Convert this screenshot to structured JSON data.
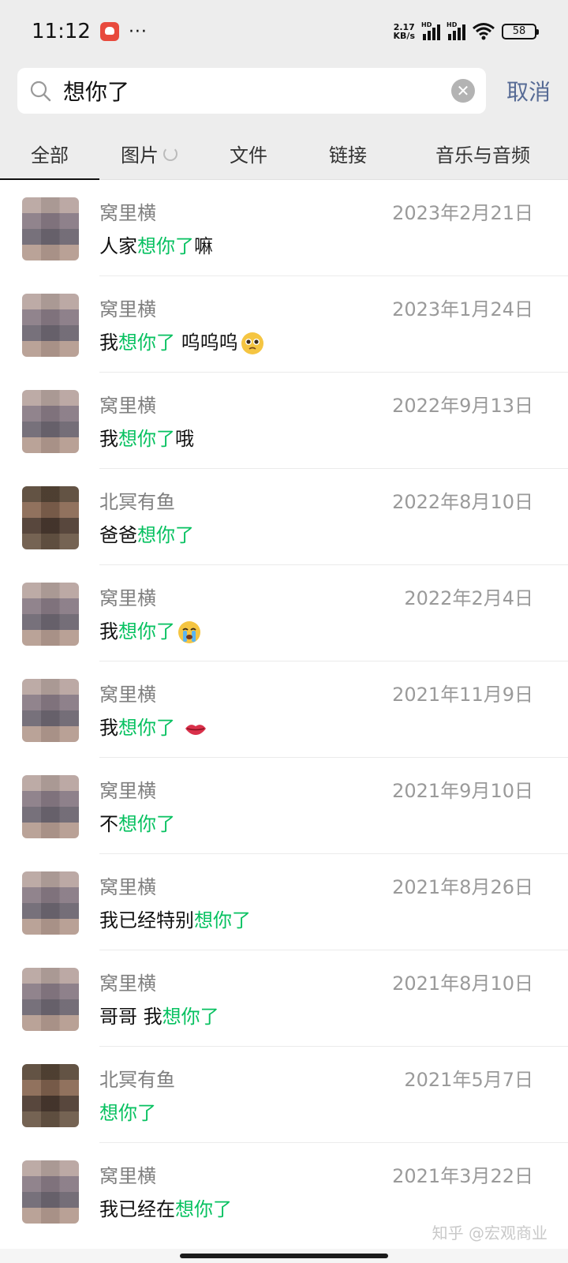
{
  "status_bar": {
    "time": "11:12",
    "dots": "···",
    "net_speed_value": "2.17",
    "net_speed_unit": "KB/s",
    "hd1": "HD",
    "hd2": "HD",
    "battery": "58"
  },
  "search": {
    "query": "想你了",
    "cancel_label": "取消"
  },
  "tabs": [
    {
      "label": "全部",
      "active": true
    },
    {
      "label": "图片",
      "active": false
    },
    {
      "label": "文件",
      "active": false
    },
    {
      "label": "链接",
      "active": false
    },
    {
      "label": "音乐与音频",
      "active": false
    }
  ],
  "highlight_color": "#07c160",
  "results": [
    {
      "sender": "窝里横",
      "date": "2023年2月21日",
      "pre": "人家",
      "hl": "想你了",
      "post": "嘛",
      "emoji": ""
    },
    {
      "sender": "窝里横",
      "date": "2023年1月24日",
      "pre": "我",
      "hl": "想你了",
      "post": " 呜呜呜",
      "emoji": "pleading-face"
    },
    {
      "sender": "窝里横",
      "date": "2022年9月13日",
      "pre": "我",
      "hl": "想你了",
      "post": "哦",
      "emoji": ""
    },
    {
      "sender": "北冥有鱼",
      "date": "2022年8月10日",
      "pre": "爸爸",
      "hl": "想你了",
      "post": "",
      "emoji": ""
    },
    {
      "sender": "窝里横",
      "date": "2022年2月4日",
      "pre": "我",
      "hl": "想你了",
      "post": "",
      "emoji": "crying-face"
    },
    {
      "sender": "窝里横",
      "date": "2021年11月9日",
      "pre": "我",
      "hl": "想你了",
      "post": " ",
      "emoji": "kiss-lips"
    },
    {
      "sender": "窝里横",
      "date": "2021年9月10日",
      "pre": "不",
      "hl": "想你了",
      "post": "",
      "emoji": ""
    },
    {
      "sender": "窝里横",
      "date": "2021年8月26日",
      "pre": "我已经特别",
      "hl": "想你了",
      "post": "",
      "emoji": ""
    },
    {
      "sender": "窝里横",
      "date": "2021年8月10日",
      "pre": "哥哥 我",
      "hl": "想你了",
      "post": "",
      "emoji": ""
    },
    {
      "sender": "北冥有鱼",
      "date": "2021年5月7日",
      "pre": "",
      "hl": "想你了",
      "post": "",
      "emoji": ""
    },
    {
      "sender": "窝里横",
      "date": "2021年3月22日",
      "pre": "我已经在",
      "hl": "想你了",
      "post": "",
      "emoji": ""
    }
  ],
  "watermark": "知乎 @宏观商业"
}
